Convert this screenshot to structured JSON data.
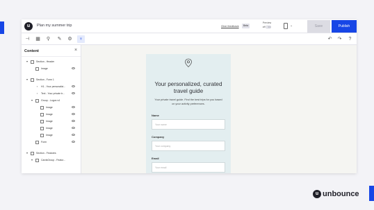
{
  "app": {
    "logo_glyph": "u",
    "page_name": "Plan my summer trip",
    "give_feedback": "Give feedback",
    "beta": "Beta",
    "preview_label": "Preview",
    "preview_state": "off",
    "device_icon": "mobile-device-icon",
    "save_label": "Save",
    "publish_label": "Publish"
  },
  "toolbar": {
    "icons": [
      "add-section-icon",
      "layout-icon",
      "sitemap-icon",
      "style-icon",
      "lightbulb-icon"
    ],
    "right_icons": [
      "undo-icon",
      "redo-icon",
      "help-icon"
    ]
  },
  "sidebar": {
    "title": "Content",
    "items": [
      {
        "label": "Section - Header",
        "toggle": "▾"
      },
      {
        "label": "Image"
      },
      {
        "label": "Section - Form 1",
        "toggle": "▾"
      },
      {
        "label": "H1 - Your personalizi..."
      },
      {
        "label": "Text - Your private tr..."
      },
      {
        "label": "Group - Logos v4",
        "toggle": "▾"
      },
      {
        "label": "Image"
      },
      {
        "label": "Image"
      },
      {
        "label": "Image"
      },
      {
        "label": "Image"
      },
      {
        "label": "Image"
      },
      {
        "label": "Form"
      },
      {
        "label": "Section - Features",
        "toggle": "▾"
      },
      {
        "label": "CardsGroup - Featur...",
        "toggle": "▾"
      }
    ]
  },
  "landing": {
    "title": "Your personalized, curated travel guide",
    "subtitle": "Your private travel guide. Find the best trips for you based on your activity preferences.",
    "fields": [
      {
        "label": "Name",
        "placeholder": "Your name"
      },
      {
        "label": "Company",
        "placeholder": "Your company"
      },
      {
        "label": "Email",
        "placeholder": "Your email"
      }
    ]
  },
  "brand": {
    "glyph": "u",
    "name": "unbounce"
  },
  "colors": {
    "accent": "#1746e6",
    "landing_bg": "#e3eef0",
    "canvas_bg": "#f5f5f2"
  }
}
